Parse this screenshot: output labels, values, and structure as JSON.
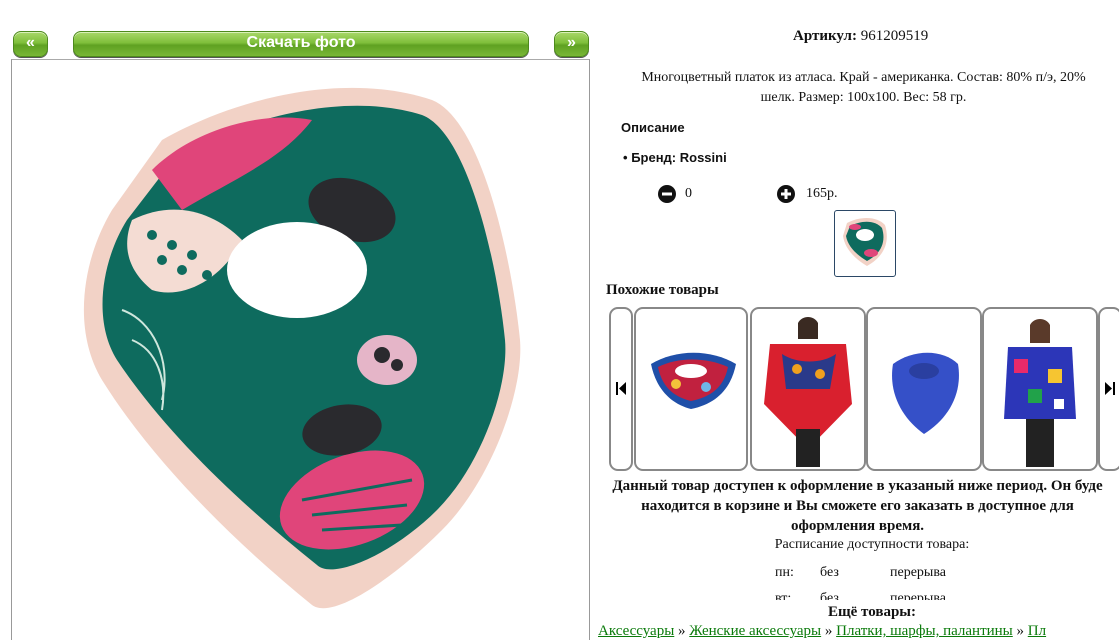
{
  "nav": {
    "prev_label": "«",
    "next_label": "»",
    "download_label": "Скачать фото"
  },
  "product": {
    "article_label": "Артикул:",
    "article_value": "961209519",
    "description_line1": "Многоцветный платок из атласа. Край - американка. Состав: 80% п/э, 20%",
    "description_line2": "шелк. Размер: 100x100. Вес: 58 гр.",
    "section_title": "Описание",
    "brand": "Бренд: Rossini",
    "quantity": "0",
    "price": "165р."
  },
  "similar": {
    "title": "Похожие товары"
  },
  "availability": {
    "line1": "Данный товар доступен к оформление в указаный ниже период. Он буде",
    "line2": "находится в корзине и Вы сможете его заказать в доступное для",
    "line3": "оформления время.",
    "schedule_title": "Расписание доступности товара:",
    "rows": [
      {
        "day": "пн:",
        "from": "без",
        "to": "перерыва"
      },
      {
        "day": "вт:",
        "from": "без",
        "to": "перерыва"
      }
    ]
  },
  "more": {
    "title": "Ещё товары:",
    "crumbs": [
      "Аксессуары",
      "Женские аксессуары",
      "Платки, шарфы, палантины",
      "Пл"
    ],
    "separator": "»"
  },
  "icons": {
    "minus": "minus-circle-icon",
    "plus": "plus-circle-icon",
    "carousel_prev": "skip-back-icon",
    "carousel_next": "skip-forward-icon"
  },
  "colors": {
    "button_green": "#7fbf3b",
    "scarf_teal": "#0e6b5e",
    "scarf_pink": "#e0457a",
    "link_green": "#0a7a0a"
  }
}
